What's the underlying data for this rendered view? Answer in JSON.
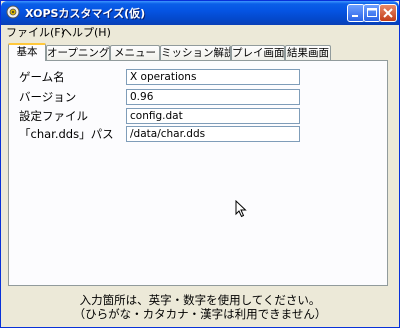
{
  "window": {
    "title": "XOPSカスタマイズ(仮)"
  },
  "menu": [
    {
      "label": "ファイル(F)"
    },
    {
      "label": "ヘルプ(H)"
    }
  ],
  "tabs": [
    {
      "label": "基本",
      "active": true
    },
    {
      "label": "オープニング",
      "active": false
    },
    {
      "label": "メニュー",
      "active": false
    },
    {
      "label": "ミッション解説",
      "active": false
    },
    {
      "label": "プレイ画面",
      "active": false
    },
    {
      "label": "結果画面",
      "active": false
    }
  ],
  "form": {
    "game_name": {
      "label": "ゲーム名",
      "value": "X operations"
    },
    "version": {
      "label": "バージョン",
      "value": "0.96"
    },
    "config_file": {
      "label": "設定ファイル",
      "value": "config.dat"
    },
    "char_path": {
      "label": "「char.dds」パス",
      "value": "/data/char.dds"
    }
  },
  "note": {
    "line1": "入力箇所は、英字・数字を使用してください。",
    "line2": "（ひらがな・カタカナ・漢字は利用できません）"
  },
  "icons": {
    "app": "app-icon",
    "minimize": "minimize-icon",
    "maximize": "maximize-icon",
    "close": "close-icon",
    "cursor": "mouse-cursor-icon"
  },
  "colors": {
    "titlebar": "#0554e3",
    "face": "#ece9d8",
    "active_tab_accent": "#ffc83c",
    "close_button": "#c33d18"
  }
}
